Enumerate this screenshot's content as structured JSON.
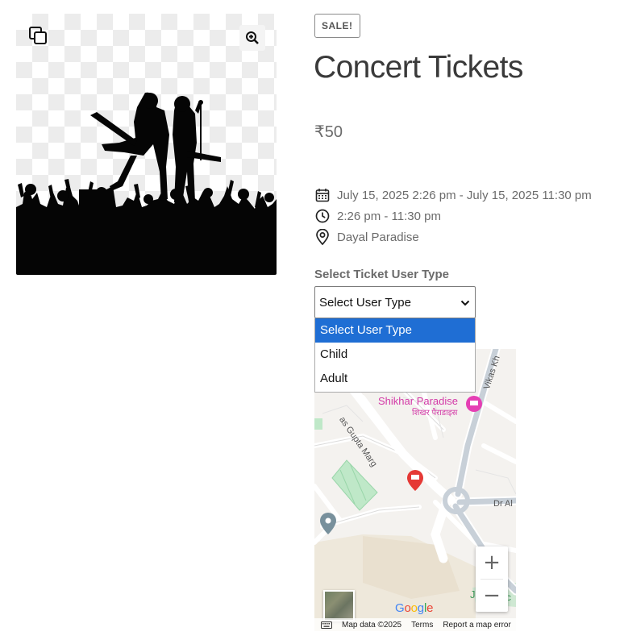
{
  "product": {
    "badge": "SALE!",
    "title": "Concert Tickets",
    "price": "₹50"
  },
  "event": {
    "date_range": "July 15, 2025 2:26 pm - July 15, 2025 11:30 pm",
    "time_range": "2:26 pm - 11:30 pm",
    "venue": "Dayal Paradise"
  },
  "ticket_select": {
    "label": "Select Ticket User Type",
    "selected_value": "Select User Type",
    "options": [
      "Select User Type",
      "Child",
      "Adult"
    ]
  },
  "map": {
    "labels": {
      "shikhar_en": "Shikhar Paradise",
      "shikhar_hi": "शिखर पैराडाइस",
      "road_gupta": "as Gupta Marg",
      "road_vikas": "Vikas Kh",
      "road_dr": "Dr Al",
      "j_label": "J",
      "c_label": "c"
    },
    "google_logo": "Google",
    "attribution": {
      "map_data": "Map data ©2025",
      "terms": "Terms",
      "report": "Report a map error"
    },
    "zoom_in": "+",
    "zoom_out": "−"
  },
  "icons": {
    "gallery": "gallery-copy-icon",
    "zoom": "magnify-plus-icon",
    "calendar": "calendar-icon",
    "clock": "clock-icon",
    "location": "map-pin-icon",
    "chevron": "chevron-down-icon",
    "keyboard": "keyboard-icon"
  },
  "colors": {
    "option_highlight": "#1f6ed4",
    "poi_pink": "#e53fb4",
    "poi_red": "#e53935",
    "park_green": "#bfe8c8"
  }
}
